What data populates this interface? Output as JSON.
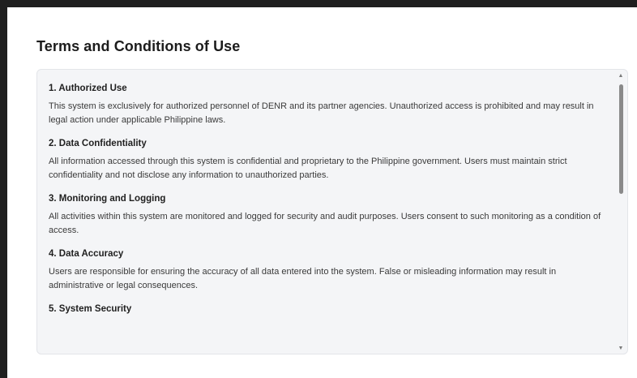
{
  "page": {
    "title": "Terms and Conditions of Use"
  },
  "terms": {
    "sections": [
      {
        "heading": "1. Authorized Use",
        "body": "This system is exclusively for authorized personnel of DENR and its partner agencies. Unauthorized access is prohibited and may result in legal action under applicable Philippine laws."
      },
      {
        "heading": "2. Data Confidentiality",
        "body": "All information accessed through this system is confidential and proprietary to the Philippine government. Users must maintain strict confidentiality and not disclose any information to unauthorized parties."
      },
      {
        "heading": "3. Monitoring and Logging",
        "body": "All activities within this system are monitored and logged for security and audit purposes. Users consent to such monitoring as a condition of access."
      },
      {
        "heading": "4. Data Accuracy",
        "body": "Users are responsible for ensuring the accuracy of all data entered into the system. False or misleading information may result in administrative or legal consequences."
      },
      {
        "heading": "5. System Security",
        "body": ""
      }
    ]
  },
  "icons": {
    "scroll_up": "triangle-up",
    "scroll_down": "triangle-down"
  },
  "colors": {
    "panel_background": "#f4f5f7",
    "scroll_thumb": "#8a8a8a"
  }
}
